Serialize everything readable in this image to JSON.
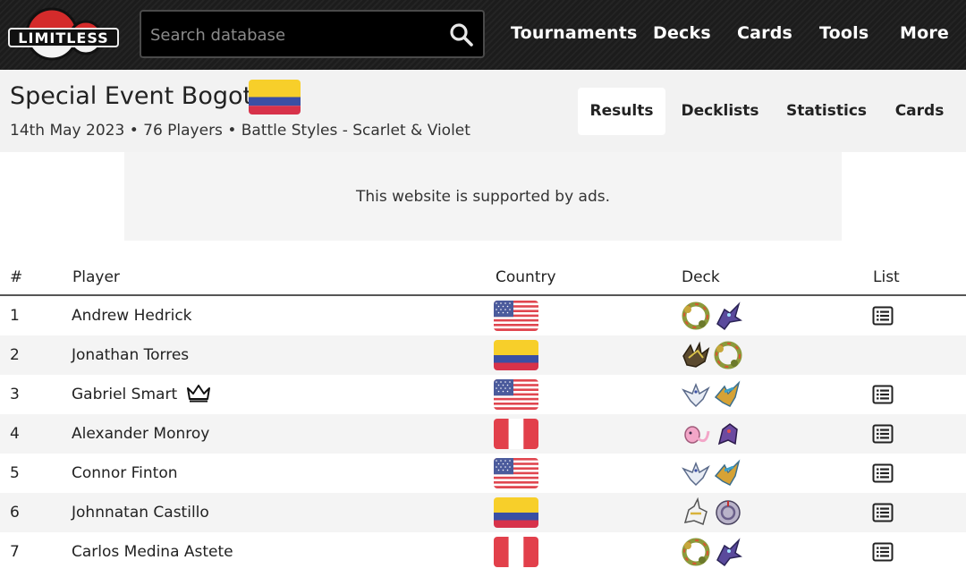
{
  "nav": {
    "logo_text": "LIMITLESS",
    "search_placeholder": "Search database",
    "links": [
      "Tournaments",
      "Decks",
      "Cards",
      "Tools",
      "More"
    ]
  },
  "event": {
    "title": "Special Event Bogotá",
    "flag": "colombia",
    "subtitle": "14th May 2023 • 76 Players • Battle Styles - Scarlet & Violet",
    "tabs": [
      "Results",
      "Decklists",
      "Statistics",
      "Cards"
    ],
    "active_tab": "Results"
  },
  "ad": {
    "text": "This website is supported by ads."
  },
  "table": {
    "headers": {
      "rank": "#",
      "player": "Player",
      "country": "Country",
      "deck": "Deck",
      "list": "List"
    },
    "rows": [
      {
        "rank": "1",
        "player": "Andrew Hedrick",
        "country": "usa",
        "deck": [
          "regidrago-icon",
          "sableye-icon"
        ],
        "list": true,
        "crown": false
      },
      {
        "rank": "2",
        "player": "Jonathan Torres",
        "country": "colombia",
        "deck": [
          "zacian-dragon-icon",
          "regidrago-icon"
        ],
        "list": false,
        "crown": false
      },
      {
        "rank": "3",
        "player": "Gabriel Smart",
        "country": "usa",
        "deck": [
          "lugia-icon",
          "archeops-icon"
        ],
        "list": true,
        "crown": true
      },
      {
        "rank": "4",
        "player": "Alexander Monroy",
        "country": "peru",
        "deck": [
          "mew-icon",
          "genesect-icon"
        ],
        "list": true,
        "crown": false
      },
      {
        "rank": "5",
        "player": "Connor Finton",
        "country": "usa",
        "deck": [
          "lugia-icon",
          "archeops-icon"
        ],
        "list": true,
        "crown": false
      },
      {
        "rank": "6",
        "player": "Johnnatan Castillo",
        "country": "colombia",
        "deck": [
          "arceus-icon",
          "giratina-icon"
        ],
        "list": true,
        "crown": false
      },
      {
        "rank": "7",
        "player": "Carlos Medina Astete",
        "country": "peru",
        "deck": [
          "regidrago-icon",
          "sableye-icon"
        ],
        "list": true,
        "crown": false
      }
    ]
  },
  "colors": {
    "topbar": "#1c1c1c",
    "header_bg": "#f2f2f2",
    "logo_red": "#d42b2b",
    "row_alt": "#f4f4f4"
  }
}
